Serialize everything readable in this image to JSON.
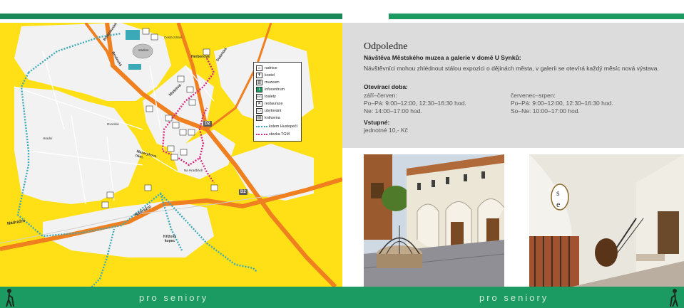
{
  "map": {
    "legend": [
      {
        "icon": "radnice",
        "label": "radnice"
      },
      {
        "icon": "kostel",
        "label": "kostel"
      },
      {
        "icon": "muzeum",
        "label": "muzeum"
      },
      {
        "icon": "infocentrum",
        "label": "infocentrum"
      },
      {
        "icon": "toalety",
        "label": "toalety"
      },
      {
        "icon": "restaurace",
        "label": "restaurace"
      },
      {
        "icon": "ubytovani",
        "label": "ubytování"
      },
      {
        "icon": "knihovna",
        "label": "knihovna"
      },
      {
        "icon": "trail",
        "label": "kolem Hustopečí",
        "color": "#3aa9b8"
      },
      {
        "icon": "trail",
        "label": "stezka TGM",
        "color": "#d6267e"
      }
    ],
    "labels": {
      "nadrazni": "Nádražní",
      "kriovy_kopec": "Křížový kopec",
      "masarykovo_nam": "Masarykovo nám.",
      "husova": "Husova",
      "brnenska": "Brněnská",
      "dukelska": "Dukelská",
      "herbenova": "Herbenova",
      "bratislavska": "Bratislavská",
      "hradni": "Hradní",
      "dvorska": "Dvorská",
      "stadion": "stadion",
      "cesta_zdravi": "Cesta zdraví",
      "na_hradbach": "Na Hradbách"
    },
    "route_badge_1": "D2",
    "route_badge_2": "D2"
  },
  "article": {
    "section_title": "Odpoledne",
    "lede": "Návštěva Městského muzea a galerie v domě U Synků:",
    "paragraph": "Návštěvníci mohou zhlédnout stálou expozici o dějinách města, v galerii se otevírá každý měsíc nová výstava.",
    "hours_heading": "Otevírací doba:",
    "season1": {
      "title": "září–červen:",
      "line1": "Po–Pá: 9:00–12:00, 12:30–16:30 hod.",
      "line2": "Ne: 14:00–17:00 hod."
    },
    "season2": {
      "title": "červenec–srpen:",
      "line1": "Po–Pá: 9:00–12:00, 12:30–16:30 hod.",
      "line2": "So–Ne: 10:00–17:00 hod."
    },
    "admission_heading": "Vstupné:",
    "admission_value": "jednotné 10,- Kč"
  },
  "footer": {
    "left_text": "pro seniory",
    "right_text": "pro seniory"
  },
  "colors": {
    "map_yellow": "#ffe017",
    "road_orange": "#ef7f1f",
    "trail_teal": "#3aa9b8",
    "trail_magenta": "#d6267e",
    "footer_green": "#1b9a61"
  }
}
